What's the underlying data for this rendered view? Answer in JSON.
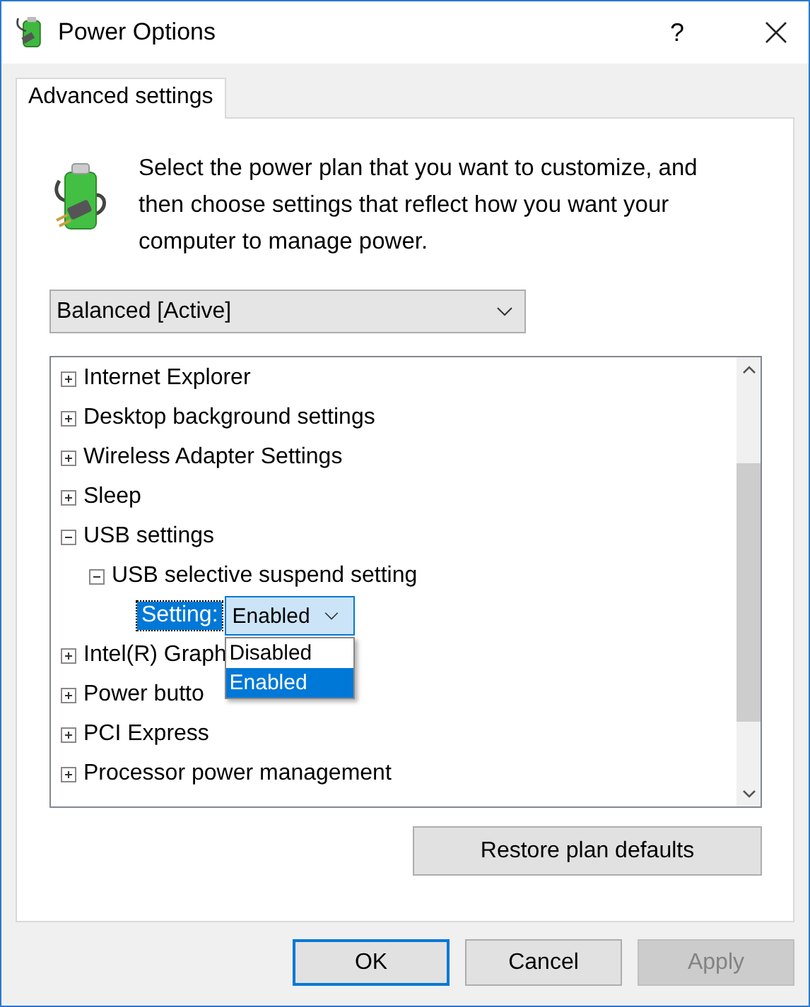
{
  "window": {
    "title": "Power Options",
    "help": "?"
  },
  "tabs": [
    {
      "label": "Advanced settings",
      "selected": true
    }
  ],
  "description": "Select the power plan that you want to customize, and then choose settings that reflect how you want your computer to manage power.",
  "plan_dropdown": {
    "value": "Balanced [Active]"
  },
  "tree": [
    {
      "label": "Internet Explorer",
      "kind": "group",
      "expanded": false
    },
    {
      "label": "Desktop background settings",
      "kind": "group",
      "expanded": false
    },
    {
      "label": "Wireless Adapter Settings",
      "kind": "group",
      "expanded": false
    },
    {
      "label": "Sleep",
      "kind": "group",
      "expanded": false
    },
    {
      "label": "USB settings",
      "kind": "group",
      "expanded": true,
      "children": [
        {
          "label": "USB selective suspend setting",
          "kind": "group",
          "expanded": true,
          "children": [
            {
              "label": "Setting:",
              "kind": "setting",
              "selected": true,
              "value": "Enabled",
              "open": true,
              "options": [
                {
                  "label": "Disabled",
                  "selected": false
                },
                {
                  "label": "Enabled",
                  "selected": true
                }
              ]
            }
          ]
        }
      ]
    },
    {
      "label": "Intel(R) Graph",
      "kind": "group",
      "expanded": false
    },
    {
      "label": "Power butto",
      "kind": "group",
      "expanded": false
    },
    {
      "label": "PCI Express",
      "kind": "group",
      "expanded": false
    },
    {
      "label": "Processor power management",
      "kind": "group",
      "expanded": false
    }
  ],
  "restore_button": "Restore plan defaults",
  "buttons": [
    {
      "label": "OK",
      "focused": true,
      "disabled": false
    },
    {
      "label": "Cancel",
      "focused": false,
      "disabled": false
    },
    {
      "label": "Apply",
      "focused": false,
      "disabled": true
    }
  ]
}
